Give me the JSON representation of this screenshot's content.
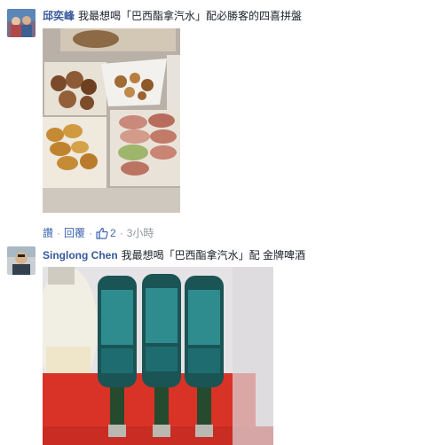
{
  "comments": [
    {
      "author": "邱奕峰",
      "text": "我最想喝「巴西酯拿汽水」配必勝客的四喜拼盤",
      "avatar_icon": "user-avatar-icon",
      "photo_label": "pizza-hut-combo-photo",
      "actions": {
        "like": "讚",
        "reply": "回覆",
        "like_count": "2",
        "time": "3小時",
        "dot": "·"
      }
    },
    {
      "author": "Singlong Chen",
      "text": "我最想喝「巴西酯拿汽水」配 金牌啤酒",
      "avatar_icon": "user-avatar-icon",
      "photo_label": "beer-bottles-photo"
    }
  ],
  "colors": {
    "link": "#365899",
    "action": "#4267b2",
    "meta": "#90949c",
    "text": "#1d2129"
  }
}
